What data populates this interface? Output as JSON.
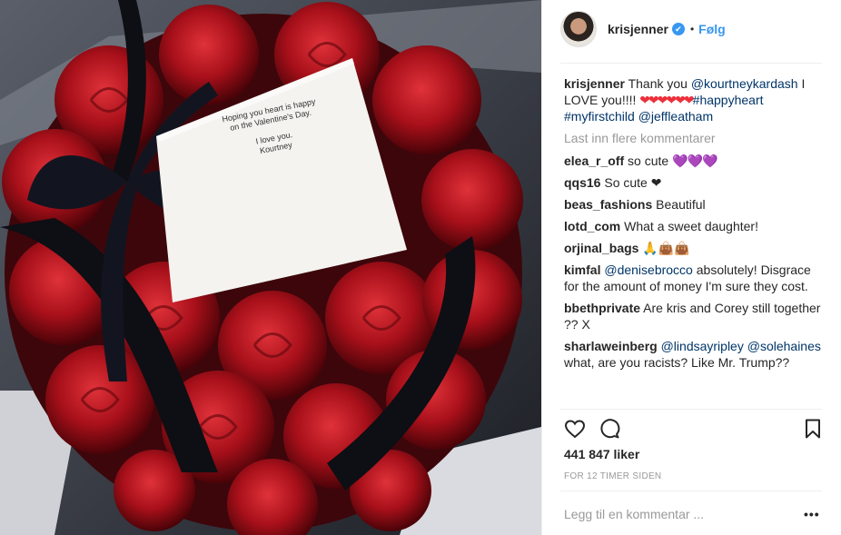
{
  "post": {
    "card_lines": [
      "Hoping you heart is happy",
      "on the Valentine's Day.",
      "I love you.",
      "Kourtney"
    ]
  },
  "header": {
    "username": "krisjenner",
    "verified_mark": "✔",
    "separator": "•",
    "follow_label": "Følg",
    "avatar_icon": "avatar"
  },
  "caption": {
    "username": "krisjenner",
    "text_start": "Thank you ",
    "mention": "@kourtneykardash",
    "text_mid": " I LOVE you!!!! ",
    "emoji": "❤❤❤❤❤❤",
    "tag1": "#happyheart",
    "tag2": "#myfirstchild",
    "tag3": "@jeffleatham"
  },
  "load_more": "Last inn flere kommentarer",
  "comments": [
    {
      "user": "elea_r_off",
      "text": "so cute ",
      "emoji": "💜💜💜"
    },
    {
      "user": "qqs16",
      "text": "So cute ❤"
    },
    {
      "user": "beas_fashions",
      "text": "Beautiful"
    },
    {
      "user": "lotd_com",
      "text": "What a sweet daughter!"
    },
    {
      "user": "orjinal_bags",
      "text": "🙏👜👜"
    },
    {
      "user": "kimfal",
      "mention": "@denisebrocco",
      "text": " absolutely! Disgrace for the amount of money I'm sure they cost."
    },
    {
      "user": "bbethprivate",
      "text": "Are kris and Corey still together ?? X"
    },
    {
      "user": "sharlaweinberg",
      "mention": "@lindsayripley",
      "mention2": "@solehaines",
      "text": " what, are you racists? Like Mr. Trump??"
    }
  ],
  "actions": {
    "like_icon": "heart-icon",
    "comment_icon": "comment-icon",
    "save_icon": "bookmark-icon"
  },
  "likes": "441 847 liker",
  "timestamp": "FOR 12 TIMER SIDEN",
  "add_comment_placeholder": "Legg til en kommentar ...",
  "options_label": "•••",
  "colors": {
    "link": "#003569",
    "follow": "#3897f0",
    "muted": "#999999",
    "rose": "#b3121a"
  }
}
